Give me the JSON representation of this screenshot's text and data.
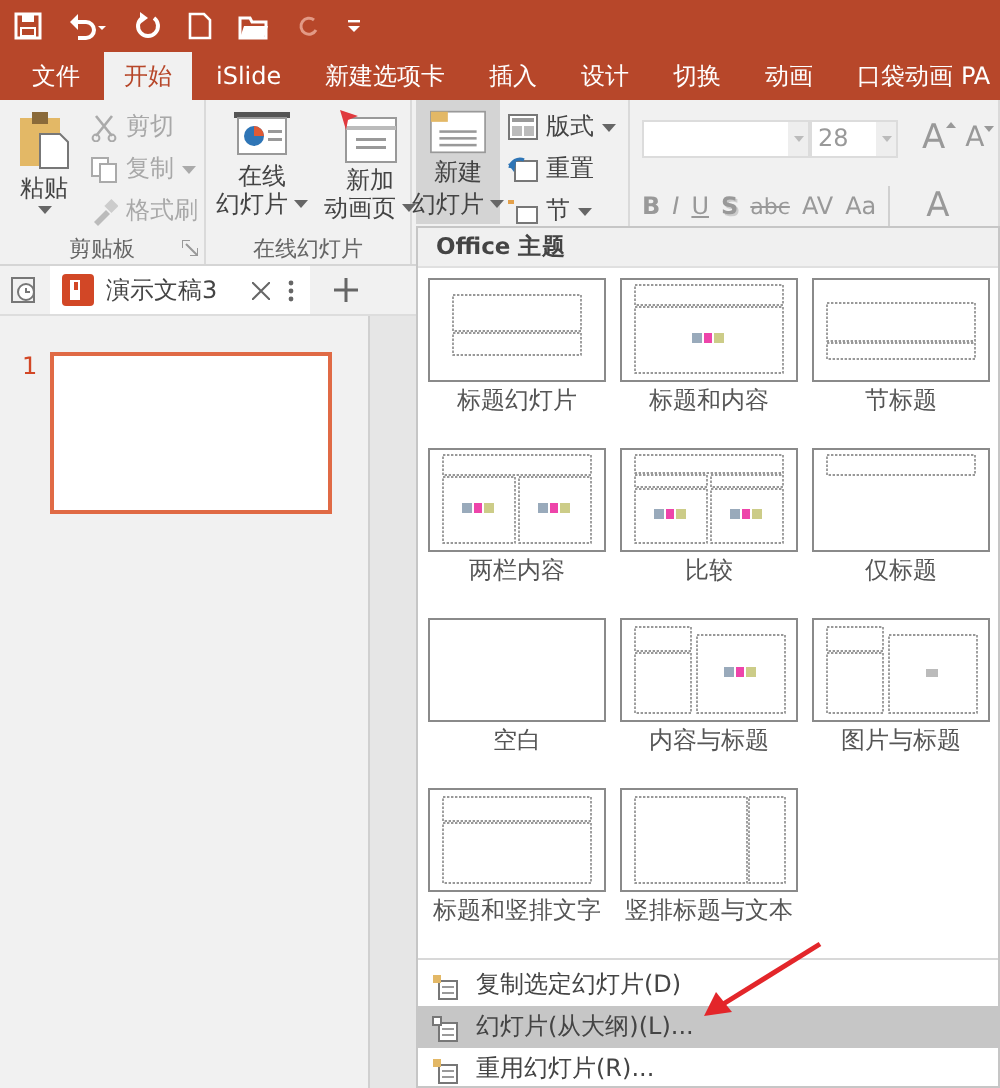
{
  "tabs": [
    {
      "label": "文件",
      "selected": false
    },
    {
      "label": "开始",
      "selected": true
    },
    {
      "label": "iSlide",
      "selected": false
    },
    {
      "label": "新建选项卡",
      "selected": false
    },
    {
      "label": "插入",
      "selected": false
    },
    {
      "label": "设计",
      "selected": false
    },
    {
      "label": "切换",
      "selected": false
    },
    {
      "label": "动画",
      "selected": false
    },
    {
      "label": "口袋动画 PA",
      "selected": false
    }
  ],
  "clipboard": {
    "paste": "粘贴",
    "label": "剪贴板",
    "items": [
      {
        "label": "剪切",
        "disabled": true,
        "kind": "cut"
      },
      {
        "label": "复制",
        "disabled": true,
        "kind": "copy"
      },
      {
        "label": "格式刷",
        "disabled": true,
        "kind": "painter"
      }
    ]
  },
  "online": {
    "label": "在线幻灯片",
    "buttons": [
      {
        "lines": [
          "在线",
          "幻灯片"
        ],
        "kind": "online"
      },
      {
        "lines": [
          "新加",
          "动画页"
        ],
        "kind": "anim"
      }
    ]
  },
  "slides": {
    "new_slide": [
      "新建",
      "幻灯片"
    ],
    "items": [
      {
        "label": "版式",
        "kind": "layout"
      },
      {
        "label": "重置",
        "kind": "reset"
      },
      {
        "label": "节",
        "kind": "section"
      }
    ]
  },
  "font": {
    "size": "28",
    "grow": "A",
    "shrink": "A",
    "format_buttons": [
      "B",
      "I",
      "U",
      "S",
      "abc",
      "AV",
      "Aa"
    ],
    "more": "A"
  },
  "document_tab": {
    "title": "演示文稿3"
  },
  "slide_pane": {
    "number": "1"
  },
  "menu": {
    "header": "Office 主题",
    "layouts": [
      {
        "name": "标题幻灯片",
        "kind": "title"
      },
      {
        "name": "标题和内容",
        "kind": "title-content"
      },
      {
        "name": "节标题",
        "kind": "section"
      },
      {
        "name": "两栏内容",
        "kind": "two-content"
      },
      {
        "name": "比较",
        "kind": "comparison"
      },
      {
        "name": "仅标题",
        "kind": "title-only"
      },
      {
        "name": "空白",
        "kind": "blank"
      },
      {
        "name": "内容与标题",
        "kind": "content-caption"
      },
      {
        "name": "图片与标题",
        "kind": "picture-caption"
      },
      {
        "name": "标题和竖排文字",
        "kind": "title-vertical"
      },
      {
        "name": "竖排标题与文本",
        "kind": "vertical-title"
      }
    ],
    "items": [
      {
        "label": "复制选定幻灯片(D)",
        "selected": false
      },
      {
        "label": "幻灯片(从大纲)(L)...",
        "selected": true
      },
      {
        "label": "重用幻灯片(R)..."
      }
    ]
  }
}
